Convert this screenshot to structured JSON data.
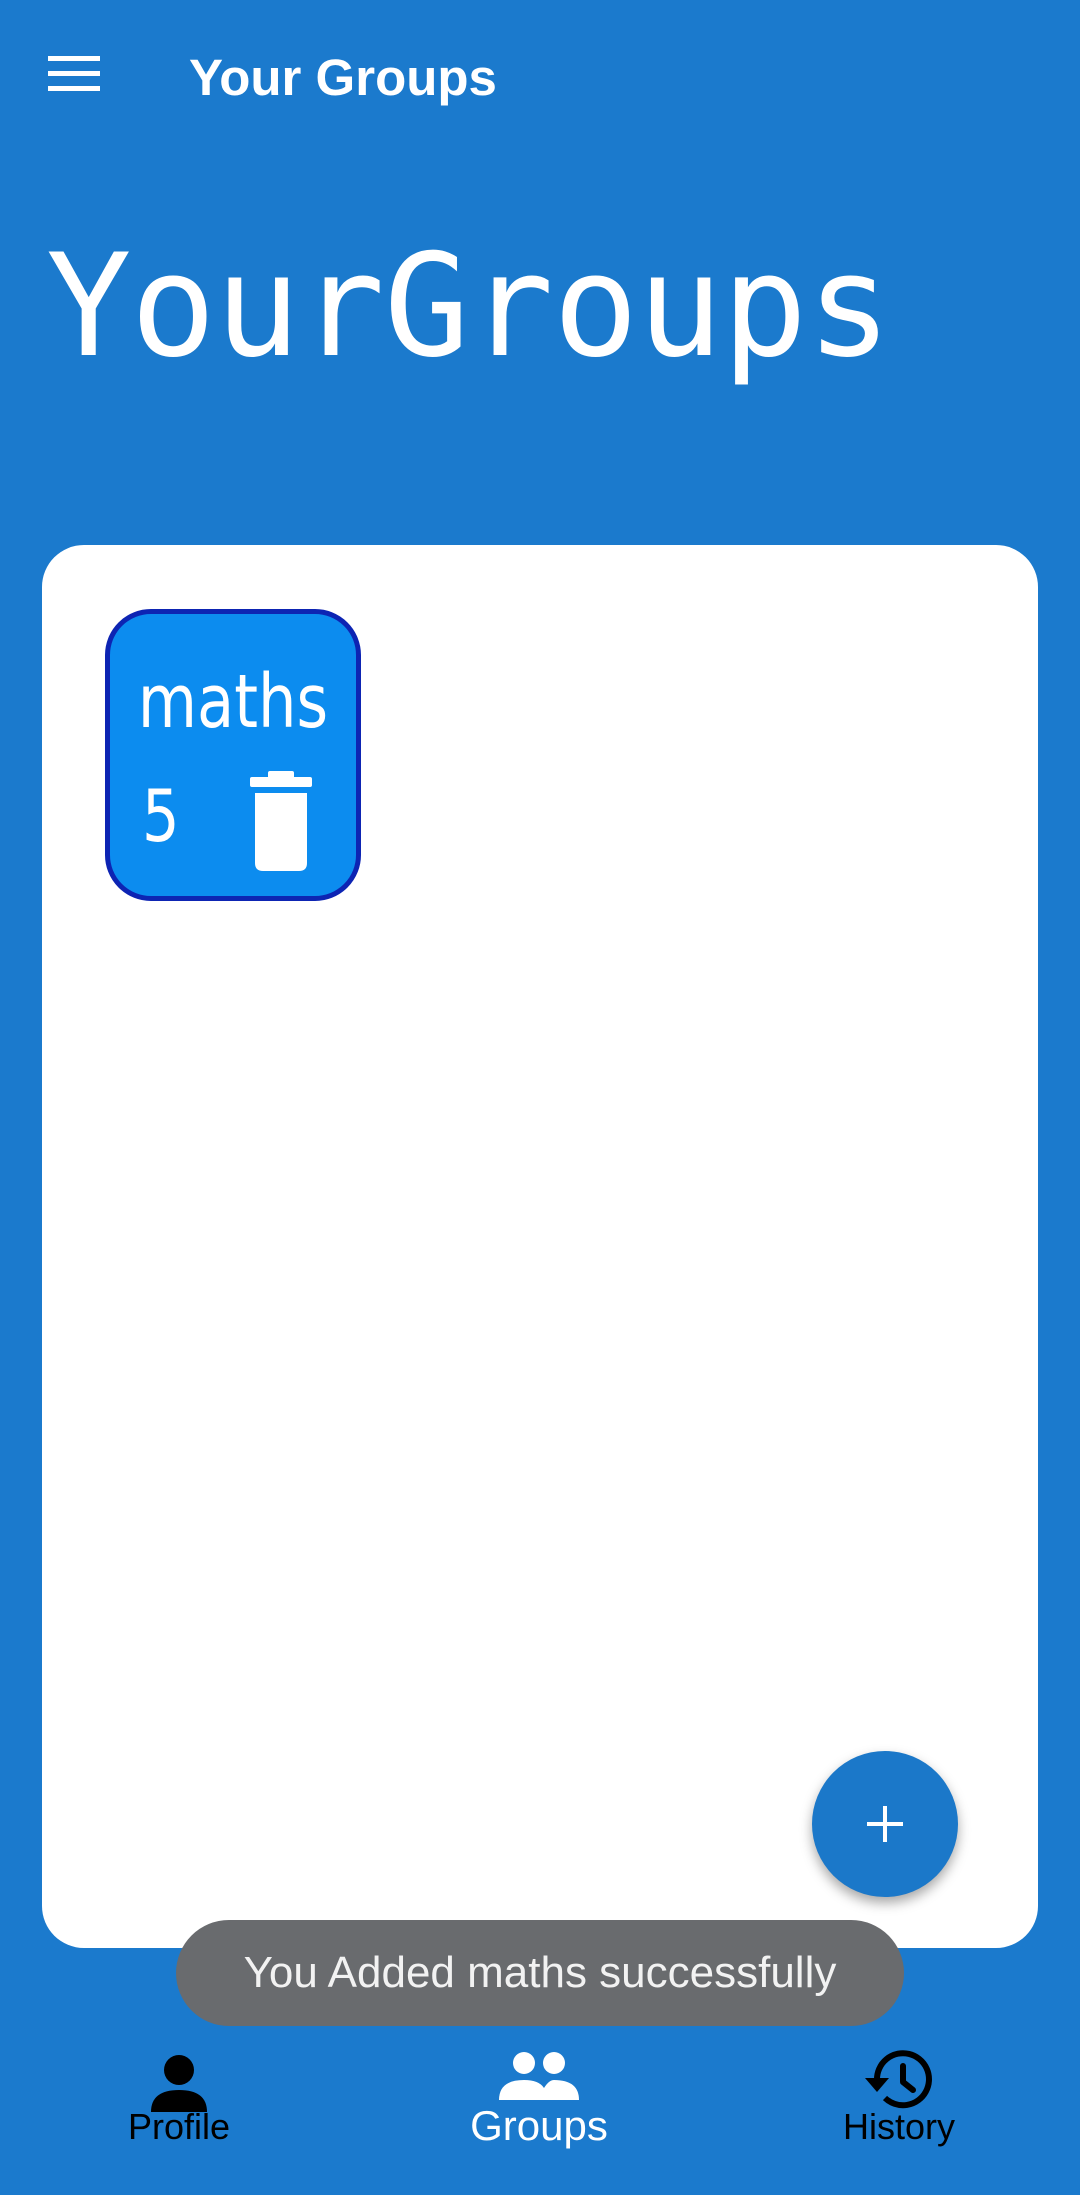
{
  "app_bar": {
    "title": "Your Groups",
    "menu_icon": "hamburger-menu-icon"
  },
  "heading": "YourGroups",
  "groups": [
    {
      "name": "maths",
      "count": "5",
      "delete_icon": "trash-icon"
    }
  ],
  "fab": {
    "icon": "plus-icon"
  },
  "toast": {
    "message": "You Added maths successfully"
  },
  "bottom_nav": {
    "items": [
      {
        "label": "Profile",
        "icon": "person-icon",
        "selected": false
      },
      {
        "label": "Groups",
        "icon": "group-icon",
        "selected": true
      },
      {
        "label": "History",
        "icon": "history-icon",
        "selected": false
      }
    ]
  },
  "colors": {
    "background": "#1b7acd",
    "card": "#ffffff",
    "tile_fill": "#0c8cef",
    "tile_border": "#0d24b3",
    "toast": "#696b6e",
    "nav_selected": "#ffffff",
    "nav_unselected": "#000000"
  }
}
